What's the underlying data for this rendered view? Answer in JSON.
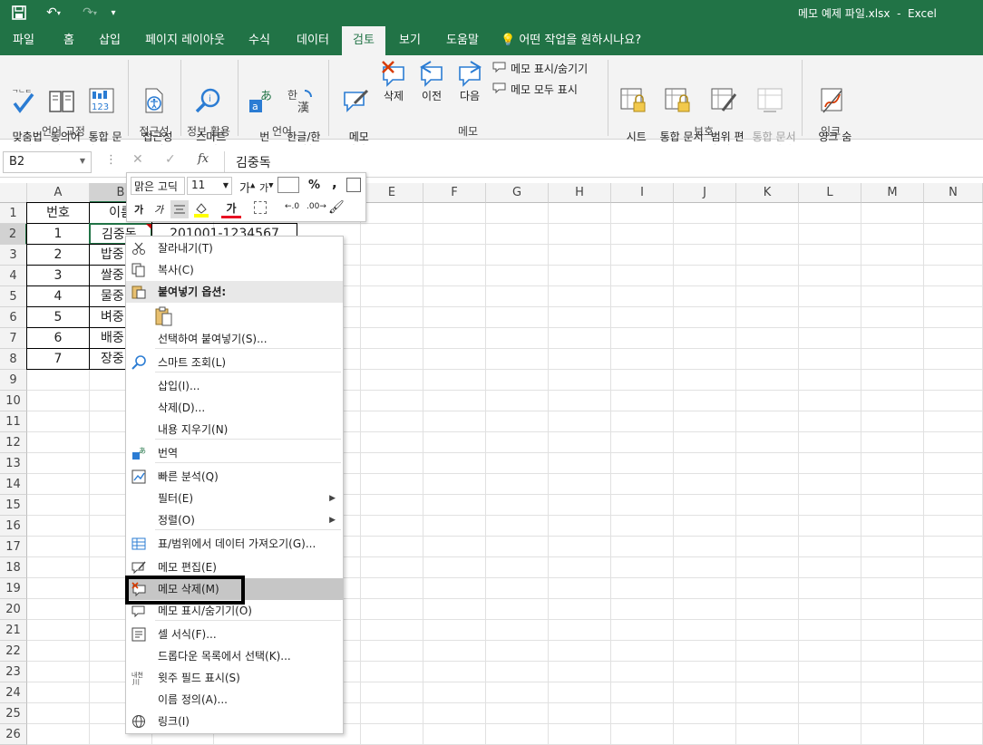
{
  "window": {
    "title": "메모 예제 파일.xlsx  -  Excel"
  },
  "tabs": [
    "파일",
    "홈",
    "삽입",
    "페이지 레이아웃",
    "수식",
    "데이터",
    "검토",
    "보기",
    "도움말"
  ],
  "active_tab": "검토",
  "tell_me": "어떤 작업을 원하시나요?",
  "ribbon": {
    "proofing": {
      "spell": "맞춤법\n검사",
      "thesaurus": "동의어\n사전",
      "stats": "통합 문\n서 통계",
      "group": "언어 교정"
    },
    "accessibility": {
      "check": "접근성\n검사",
      "group": "접근성"
    },
    "insights": {
      "smart": "스마트\n조회",
      "group": "정보 활용"
    },
    "language": {
      "translate": "번\n역",
      "hanja": "한글/한\n자 변환",
      "group": "언어"
    },
    "comments": {
      "edit": "메모\n편집",
      "delete": "삭제",
      "prev": "이전",
      "next": "다음",
      "show_hide": "메모 표시/숨기기",
      "show_all": "메모 모두 표시",
      "group": "메모"
    },
    "protect": {
      "sheet": "시트\n보호",
      "workbook": "통합 문서\n보호",
      "ranges": "범위 편\n집 허용",
      "unshare": "통합 문서\n공유 해제",
      "group": "보호"
    },
    "ink": {
      "hide": "잉크 숨\n기기",
      "group": "잉크"
    }
  },
  "formula_bar": {
    "name_box": "B2",
    "value": "김중독",
    "fx": "fx"
  },
  "columns": [
    "A",
    "B",
    "C",
    "D",
    "E",
    "F",
    "G",
    "H",
    "I",
    "J",
    "K",
    "L",
    "M",
    "N"
  ],
  "rows": [
    "1",
    "2",
    "3",
    "4",
    "5",
    "6",
    "7",
    "8",
    "9",
    "10",
    "11",
    "12",
    "13",
    "14",
    "15",
    "16",
    "17",
    "18",
    "19",
    "20",
    "21",
    "22",
    "23",
    "24",
    "25",
    "26"
  ],
  "cells": {
    "A": [
      "번호",
      "1",
      "2",
      "3",
      "4",
      "5",
      "6",
      "7"
    ],
    "B": [
      "이름",
      "김중독",
      "밥중",
      "쌀중",
      "물중",
      "벼중",
      "배중",
      "장중"
    ],
    "C2": "201001-1234567"
  },
  "mini_toolbar": {
    "font": "맑은 고딕",
    "size": "11",
    "percent": "%",
    "comma": ","
  },
  "context_menu": [
    {
      "label": "잘라내기(T)",
      "icon": "scissors-icon"
    },
    {
      "label": "복사(C)",
      "icon": "copy-icon"
    },
    {
      "label": "붙여넣기 옵션:",
      "icon": "paste-icon",
      "header": true
    },
    {
      "label": "",
      "icon": "paste-clipboard-icon",
      "paste_icons": true
    },
    {
      "label": "선택하여 붙여넣기(S)...",
      "icon": ""
    },
    {
      "label": "스마트 조회(L)",
      "icon": "smart-lookup-icon"
    },
    {
      "label": "삽입(I)...",
      "icon": ""
    },
    {
      "label": "삭제(D)...",
      "icon": ""
    },
    {
      "label": "내용 지우기(N)",
      "icon": ""
    },
    {
      "label": "번역",
      "icon": "translate-icon"
    },
    {
      "label": "빠른 분석(Q)",
      "icon": "quick-analysis-icon"
    },
    {
      "label": "필터(E)",
      "icon": "",
      "submenu": true
    },
    {
      "label": "정렬(O)",
      "icon": "",
      "submenu": true
    },
    {
      "label": "표/범위에서 데이터 가져오기(G)...",
      "icon": "table-icon"
    },
    {
      "label": "메모 편집(E)",
      "icon": "edit-comment-icon"
    },
    {
      "label": "메모 삭제(M)",
      "icon": "delete-comment-icon",
      "highlighted": true
    },
    {
      "label": "메모 표시/숨기기(O)",
      "icon": "show-comment-icon"
    },
    {
      "label": "셀 서식(F)...",
      "icon": "format-cells-icon"
    },
    {
      "label": "드롭다운 목록에서 선택(K)...",
      "icon": ""
    },
    {
      "label": "윗주 필드 표시(S)",
      "icon": "phonetic-icon"
    },
    {
      "label": "이름 정의(A)...",
      "icon": ""
    },
    {
      "label": "링크(I)",
      "icon": "link-icon"
    }
  ],
  "colors": {
    "brand": "#217346",
    "highlight": "#c6c6c6"
  }
}
